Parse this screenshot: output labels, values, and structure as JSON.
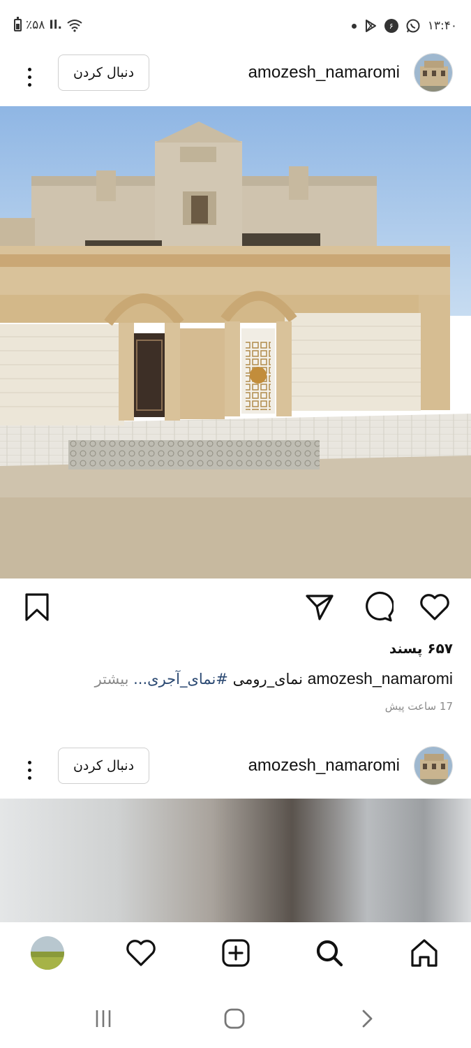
{
  "status_bar": {
    "battery": "٪۵۸",
    "signal": "Il.",
    "badge": "۶",
    "time": "۱۳:۴۰"
  },
  "post1": {
    "username": "amozesh_namaromi",
    "follow_label": "دنبال کردن",
    "likes": "۶۵۷ پسند",
    "caption_user": "amozesh_namaromi",
    "caption_text": " نمای_رومی ",
    "caption_hashtag": "#نمای_آجری...",
    "caption_more": " بیشتر",
    "timestamp": "17 ساعت پیش"
  },
  "post2": {
    "username": "amozesh_namaromi",
    "follow_label": "دنبال کردن"
  },
  "icons": {
    "more": "more-vertical-icon",
    "bookmark": "bookmark-icon",
    "share": "send-icon",
    "comment": "comment-icon",
    "like": "heart-icon",
    "home": "home-icon",
    "search": "search-icon",
    "create": "plus-square-icon",
    "activity": "heart-icon"
  },
  "colors": {
    "hashtag": "#2c4a73",
    "secondary_text": "#8a8a8a",
    "sky": "#a9c8ea",
    "facade": "#d9c6a4"
  }
}
